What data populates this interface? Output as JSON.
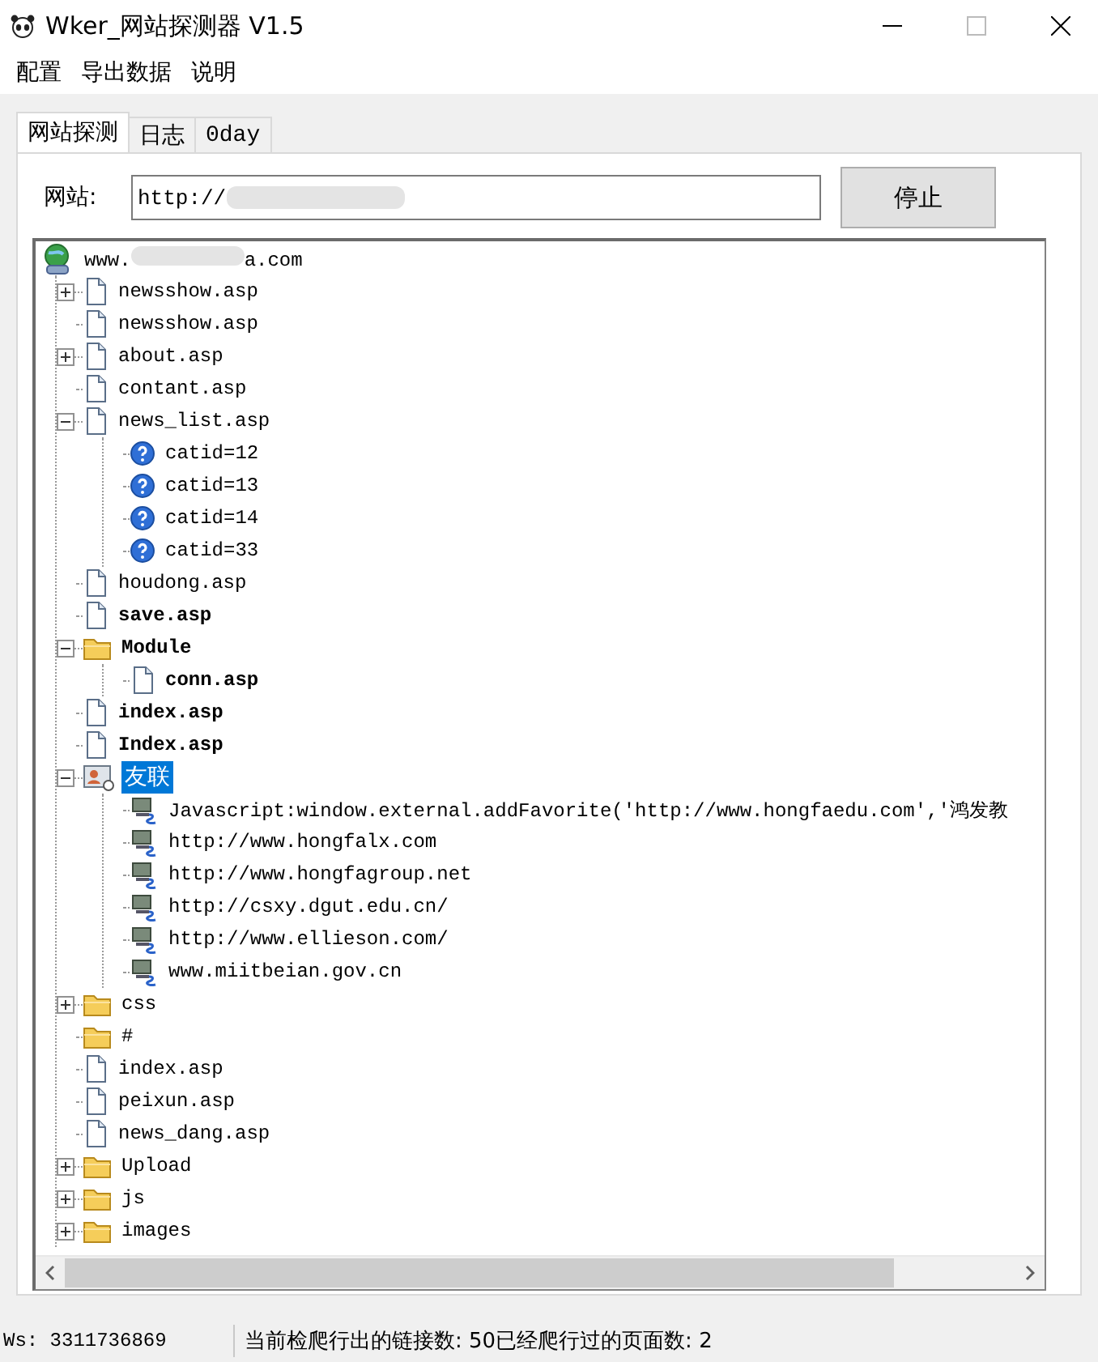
{
  "window": {
    "title": "Wker_网站探测器 V1.5"
  },
  "menu": [
    "配置",
    "导出数据",
    "说明"
  ],
  "tabs": [
    {
      "label": "网站探测",
      "selected": true
    },
    {
      "label": "日志",
      "selected": false
    },
    {
      "label": "0day",
      "selected": false
    }
  ],
  "site_field": {
    "label": "网站:",
    "value": "http://"
  },
  "stop_button": "停止",
  "tree": {
    "root": {
      "label": "www.",
      "label_tail": "a.com",
      "kind": "site",
      "children": [
        {
          "label": "newsshow.asp",
          "kind": "page",
          "bold": false,
          "selected": false,
          "expanded": false
        },
        {
          "label": "newsshow.asp",
          "kind": "page",
          "bold": false,
          "selected": false
        },
        {
          "label": "about.asp",
          "kind": "page",
          "bold": false,
          "selected": false,
          "expanded": false
        },
        {
          "label": "contant.asp",
          "kind": "page",
          "bold": false,
          "selected": false
        },
        {
          "label": "news_list.asp",
          "kind": "page",
          "bold": false,
          "selected": false,
          "expanded": true,
          "children": [
            {
              "label": "catid=12",
              "kind": "query",
              "bold": false,
              "selected": false
            },
            {
              "label": "catid=13",
              "kind": "query",
              "bold": false,
              "selected": false
            },
            {
              "label": "catid=14",
              "kind": "query",
              "bold": false,
              "selected": false
            },
            {
              "label": "catid=33",
              "kind": "query",
              "bold": false,
              "selected": false
            }
          ]
        },
        {
          "label": "houdong.asp",
          "kind": "page",
          "bold": false,
          "selected": false
        },
        {
          "label": "save.asp",
          "kind": "page",
          "bold": true,
          "selected": false
        },
        {
          "label": "Module",
          "kind": "folder",
          "bold": true,
          "selected": false,
          "expanded": true,
          "children": [
            {
              "label": "conn.asp",
              "kind": "page",
              "bold": true,
              "selected": false
            }
          ]
        },
        {
          "label": "index.asp",
          "kind": "page",
          "bold": true,
          "selected": false
        },
        {
          "label": "Index.asp",
          "kind": "page",
          "bold": true,
          "selected": false
        },
        {
          "label": "友联",
          "kind": "contacts",
          "bold": false,
          "selected": true,
          "expanded": true,
          "children": [
            {
              "label": "Javascript:window.external.addFavorite('http://www.hongfaedu.com','鸿发教",
              "kind": "link",
              "bold": false,
              "selected": false
            },
            {
              "label": "http://www.hongfalx.com",
              "kind": "link",
              "bold": false,
              "selected": false
            },
            {
              "label": "http://www.hongfagroup.net",
              "kind": "link",
              "bold": false,
              "selected": false
            },
            {
              "label": "http://csxy.dgut.edu.cn/",
              "kind": "link",
              "bold": false,
              "selected": false
            },
            {
              "label": "http://www.ellieson.com/",
              "kind": "link",
              "bold": false,
              "selected": false
            },
            {
              "label": "www.miitbeian.gov.cn",
              "kind": "link",
              "bold": false,
              "selected": false
            }
          ]
        },
        {
          "label": "css",
          "kind": "folder",
          "bold": false,
          "selected": false,
          "expanded": false
        },
        {
          "label": "#",
          "kind": "folder",
          "bold": false,
          "selected": false
        },
        {
          "label": "index.asp",
          "kind": "page",
          "bold": false,
          "selected": false
        },
        {
          "label": "peixun.asp",
          "kind": "page",
          "bold": false,
          "selected": false
        },
        {
          "label": "news_dang.asp",
          "kind": "page",
          "bold": false,
          "selected": false
        },
        {
          "label": "Upload",
          "kind": "folder",
          "bold": false,
          "selected": false,
          "expanded": false
        },
        {
          "label": "js",
          "kind": "folder",
          "bold": false,
          "selected": false,
          "expanded": false
        },
        {
          "label": "images",
          "kind": "folder",
          "bold": false,
          "selected": false,
          "expanded": false
        }
      ]
    }
  },
  "status_bar": [
    "Ws: 3311736869",
    "当前检爬行出的链接数: 50已经爬行过的页面数: 2"
  ]
}
